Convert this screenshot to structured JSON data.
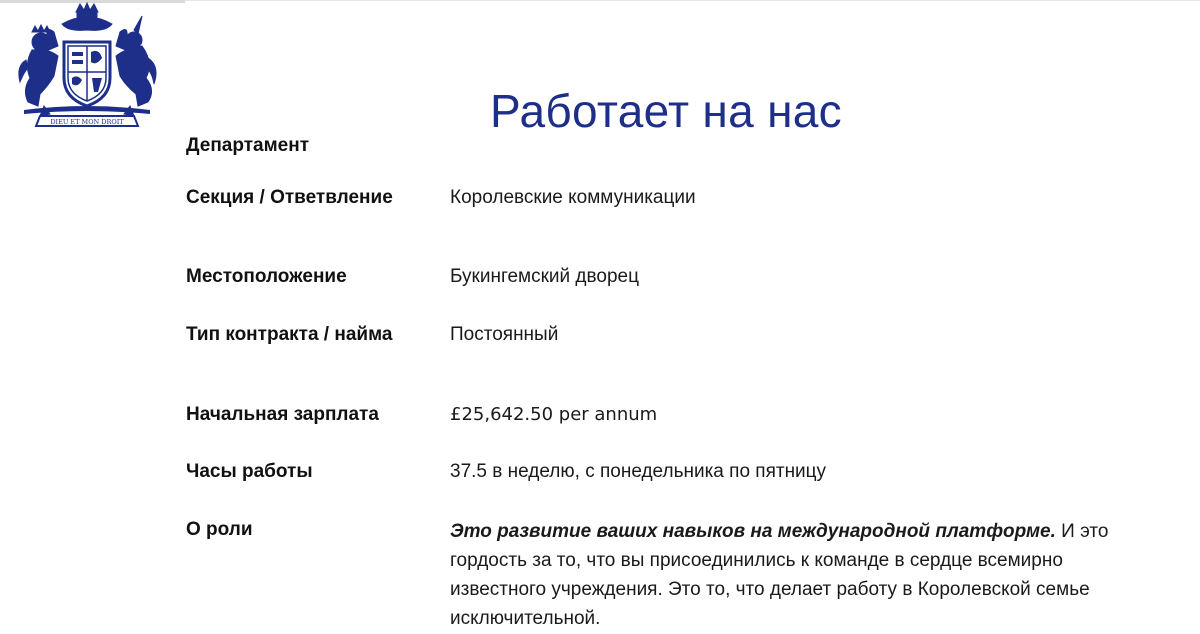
{
  "page": {
    "title": "Работает на нас"
  },
  "crest": {
    "motto": "DIEU ET MON DROIT"
  },
  "details": [
    {
      "label": "Департамент",
      "value": ""
    },
    {
      "label": "Секция / Ответвление",
      "value": "Королевские коммуникации"
    },
    {
      "label": "Местоположение",
      "value": "Букингемский дворец"
    },
    {
      "label": "Тип контракта / найма",
      "value": "Постоянный"
    },
    {
      "label": "Начальная зарплата",
      "value": "£25,642.50 per annum"
    },
    {
      "label": "Часы работы",
      "value": "37.5 в неделю, с понедельника по пятницу"
    }
  ],
  "about": {
    "label": "О роли",
    "lead": "Это развитие ваших навыков на международной платформе.",
    "body": " И это гордость за то, что вы присоединились к команде в сердце всемирно известного учреждения. Это то, что делает работу в Королевской семье исключительной."
  },
  "colors": {
    "title": "#1e2f8a",
    "crest": "#1e2f8a"
  }
}
